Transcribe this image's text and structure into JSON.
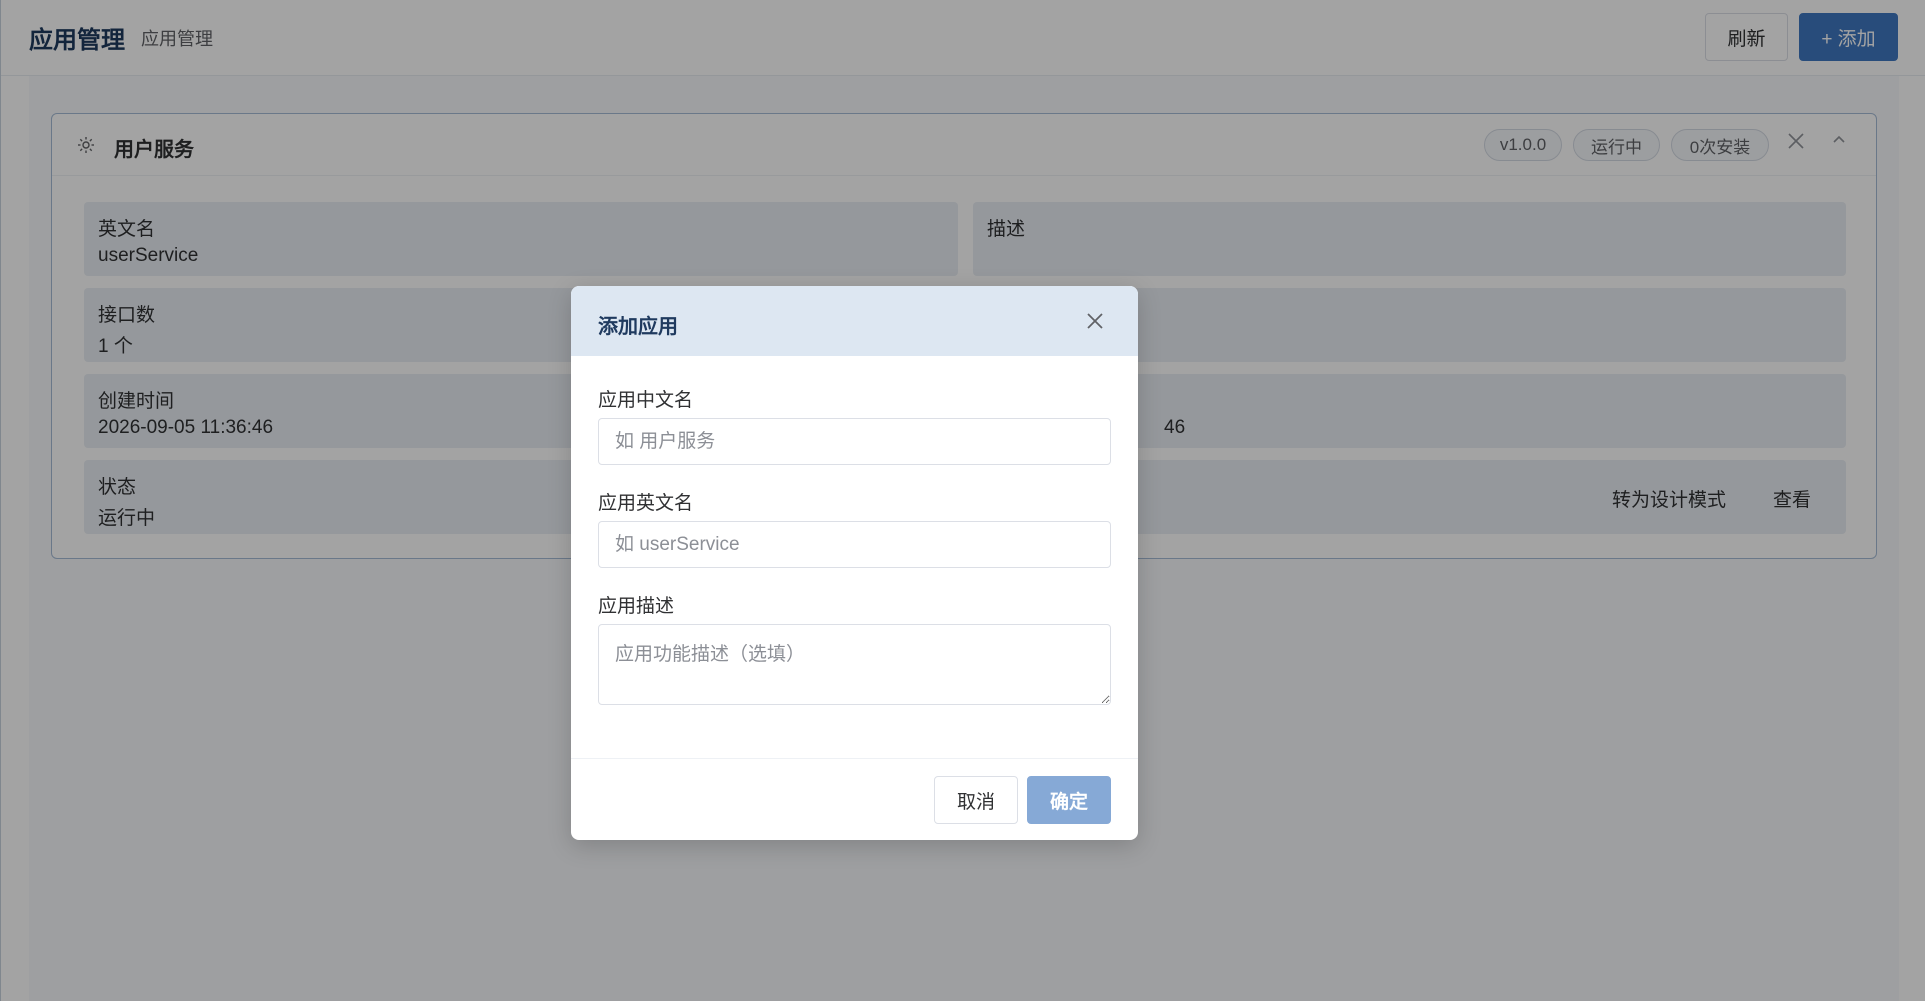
{
  "header": {
    "title": "应用管理",
    "breadcrumb": "应用管理",
    "refresh_label": "刷新",
    "add_label": "+ 添加"
  },
  "app_card": {
    "icon": "gear-icon",
    "name": "用户服务",
    "tags": {
      "version": "v1.0.0",
      "status": "运行中",
      "installs": "0次安装"
    },
    "fields": {
      "english_name": {
        "label": "英文名",
        "value": "userService"
      },
      "description": {
        "label": "描述",
        "value": ""
      },
      "api_count": {
        "label": "接口数",
        "value": "1 个"
      },
      "created_at": {
        "label": "创建时间",
        "value": "2026-09-05 11:36:46"
      },
      "updated_partial": "46",
      "status": {
        "label": "状态",
        "value": "运行中"
      }
    },
    "actions": {
      "design_mode": "转为设计模式",
      "view": "查看"
    }
  },
  "dialog": {
    "title": "添加应用",
    "cn_name_label": "应用中文名",
    "cn_name_placeholder": "如 用户服务",
    "en_name_label": "应用英文名",
    "en_name_placeholder": "如 userService",
    "desc_label": "应用描述",
    "desc_placeholder": "应用功能描述（选填）",
    "cancel_label": "取消",
    "confirm_label": "确定"
  },
  "colors": {
    "primary": "#3f78c0",
    "primary_disabled": "#86a9d6",
    "title_text": "#1f3a5f",
    "dialog_header_bg": "#dde7f2"
  }
}
